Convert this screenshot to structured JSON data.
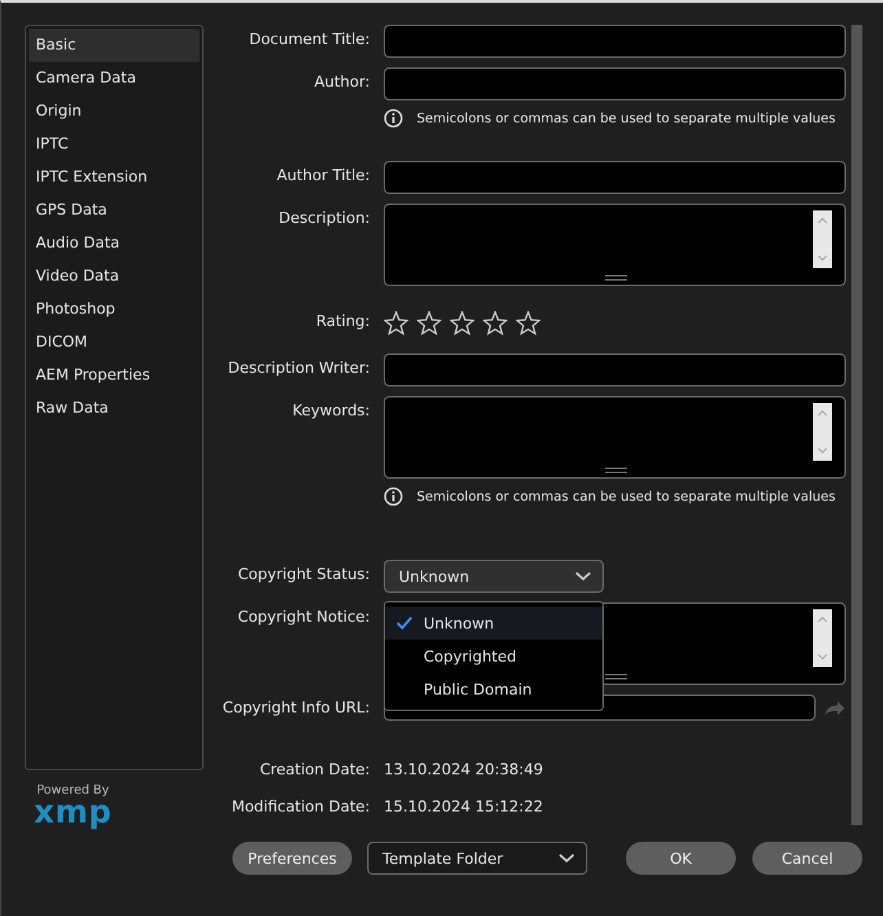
{
  "sidebar": {
    "items": [
      {
        "label": "Basic",
        "selected": true
      },
      {
        "label": "Camera Data",
        "selected": false
      },
      {
        "label": "Origin",
        "selected": false
      },
      {
        "label": "IPTC",
        "selected": false
      },
      {
        "label": "IPTC Extension",
        "selected": false
      },
      {
        "label": "GPS Data",
        "selected": false
      },
      {
        "label": "Audio Data",
        "selected": false
      },
      {
        "label": "Video Data",
        "selected": false
      },
      {
        "label": "Photoshop",
        "selected": false
      },
      {
        "label": "DICOM",
        "selected": false
      },
      {
        "label": "AEM Properties",
        "selected": false
      },
      {
        "label": "Raw Data",
        "selected": false
      }
    ]
  },
  "branding": {
    "powered_by": "Powered By",
    "logo": "xmp"
  },
  "form": {
    "rows": [
      {
        "kind": "text",
        "label": "Document Title:"
      },
      {
        "kind": "text",
        "label": "Author:"
      },
      {
        "kind": "hint",
        "text": "Semicolons or commas can be used to separate multiple values"
      },
      {
        "kind": "text",
        "label": "Author Title:"
      },
      {
        "kind": "textarea",
        "label": "Description:"
      },
      {
        "kind": "rating",
        "label": "Rating:",
        "stars": 0
      },
      {
        "kind": "text",
        "label": "Description Writer:"
      },
      {
        "kind": "textarea",
        "label": "Keywords:"
      },
      {
        "kind": "hint",
        "text": "Semicolons or commas can be used to separate multiple values"
      }
    ]
  },
  "copyright": {
    "status_label": "Copyright Status:",
    "status_value": "Unknown",
    "notice_label": "Copyright Notice:",
    "url_label": "Copyright Info URL:",
    "menu": [
      {
        "label": "Unknown",
        "selected": true
      },
      {
        "label": "Copyrighted",
        "selected": false
      },
      {
        "label": "Public Domain",
        "selected": false
      }
    ]
  },
  "dates": [
    {
      "label": "Creation Date:",
      "value": "13.10.2024 20:38:49"
    },
    {
      "label": "Modification Date:",
      "value": "15.10.2024 15:12:22"
    }
  ],
  "footer": {
    "preferences": "Preferences",
    "template_folder": "Template Folder",
    "ok": "OK",
    "cancel": "Cancel"
  }
}
